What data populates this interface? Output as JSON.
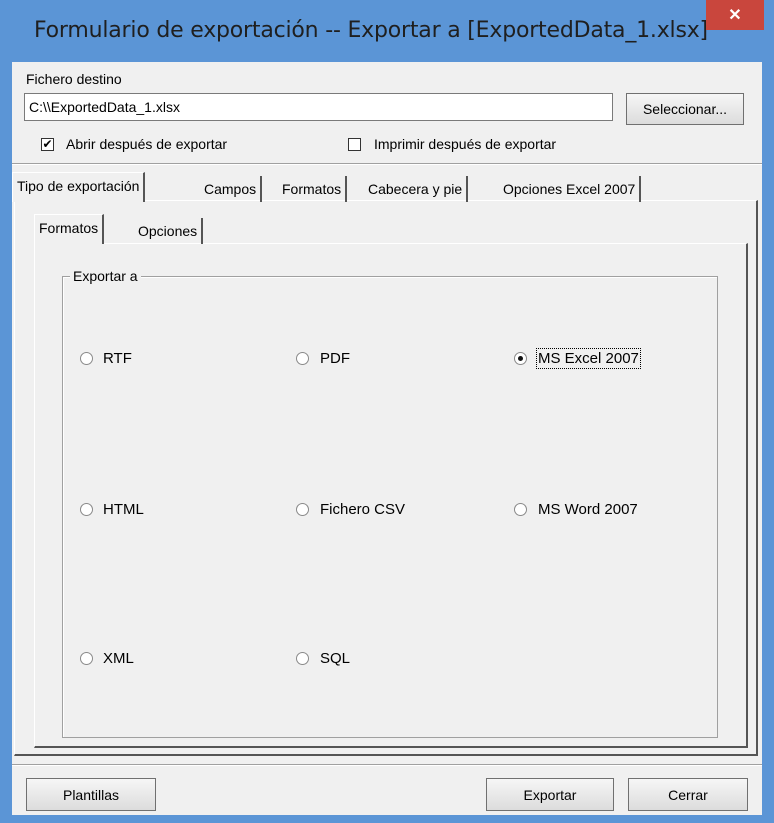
{
  "window": {
    "title": "Formulario de exportación -- Exportar a [ExportedData_1.xlsx]",
    "close_symbol": "✕"
  },
  "destination": {
    "label": "Fichero destino",
    "path": "C:\\\\ExportedData_1.xlsx",
    "select_button": "Seleccionar..."
  },
  "options": {
    "open_after": {
      "label": "Abrir después de exportar",
      "checked": true
    },
    "print_after": {
      "label": "Imprimir después de exportar",
      "checked": false
    }
  },
  "main_tabs": [
    "Tipo de exportación",
    "Campos",
    "Formatos",
    "Cabecera y pie",
    "Opciones Excel 2007"
  ],
  "sub_tabs": [
    "Formatos",
    "Opciones"
  ],
  "export_group": {
    "title": "Exportar a",
    "formats": [
      "RTF",
      "PDF",
      "MS Excel 2007",
      "HTML",
      "Fichero CSV",
      "MS Word 2007",
      "XML",
      "SQL"
    ],
    "selected": "MS Excel 2007"
  },
  "footer": {
    "templates_button": "Plantillas",
    "export_button": "Exportar",
    "close_button": "Cerrar"
  },
  "colors": {
    "title_bar": "#5b95d6",
    "close_button": "#c9463d",
    "dialog_bg": "#f0f0f0"
  }
}
